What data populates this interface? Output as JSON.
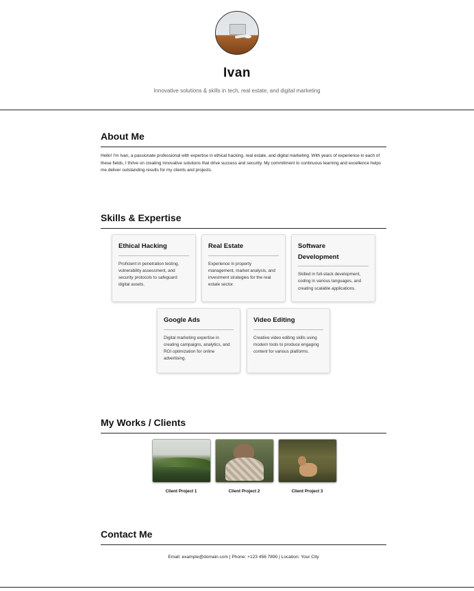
{
  "header": {
    "name": "Ivan",
    "tagline": "Innovative solutions & skills in tech, real estate, and digital marketing"
  },
  "about": {
    "title": "About Me",
    "text": "Hello! I'm Ivan, a passionate professional with expertise in ethical hacking, real estate, and digital marketing. With years of experience in each of these fields, I thrive on creating innovative solutions that drive success and security. My commitment to continuous learning and excellence helps me deliver outstanding results for my clients and projects."
  },
  "skills": {
    "title": "Skills & Expertise",
    "items": [
      {
        "name": "Ethical Hacking",
        "desc": "Proficient in penetration testing, vulnerability assessment, and security protocols to safeguard digital assets."
      },
      {
        "name": "Real Estate",
        "desc": "Experience in property management, market analysis, and investment strategies for the real estate sector."
      },
      {
        "name": "Software Development",
        "desc": "Skilled in full-stack development, coding in various languages, and creating scalable applications."
      },
      {
        "name": "Google Ads",
        "desc": "Digital marketing expertise in creating campaigns, analytics, and ROI optimization for online advertising."
      },
      {
        "name": "Video Editing",
        "desc": "Creative video editing skills using modern tools to produce engaging content for various platforms."
      }
    ]
  },
  "works": {
    "title": "My Works / Clients",
    "items": [
      {
        "caption": "Client Project 1",
        "image": "mountain-landscape"
      },
      {
        "caption": "Client Project 2",
        "image": "person-in-blanket"
      },
      {
        "caption": "Client Project 3",
        "image": "deer-in-forest"
      }
    ]
  },
  "contact": {
    "title": "Contact Me",
    "line": "Email: example@domain.com | Phone: +123 456 7890 | Location: Your City"
  }
}
